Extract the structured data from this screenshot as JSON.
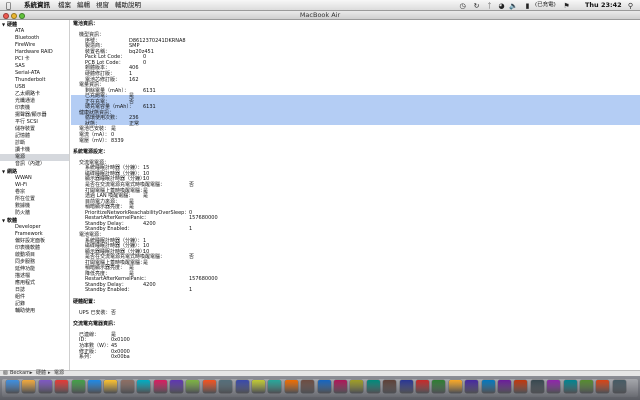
{
  "menubar": {
    "apple": "",
    "items": [
      "系統資訊",
      "檔案",
      "編輯",
      "視窗",
      "輔助說明"
    ],
    "clock": "Thu 23:42",
    "status_text": "(已充電)"
  },
  "window": {
    "title": "MacBook Air"
  },
  "sidebar": {
    "groups": [
      {
        "label": "硬體",
        "top": 0,
        "items": [
          "ATA",
          "Bluetooth",
          "FireWire",
          "Hardware RAID",
          "PCI 卡",
          "SAS",
          "Serial-ATA",
          "Thunderbolt",
          "USB",
          "乙太網路卡",
          "光纖通道",
          "印表機",
          "揚聲器/顯示器",
          "平行 SCSI",
          "儲存裝置",
          "記憶體",
          "診斷",
          "讀卡機",
          "電源",
          "音訊（內建）"
        ]
      },
      {
        "label": "網路",
        "items": [
          "WWAN",
          "Wi-Fi",
          "卷宗",
          "所在位置",
          "數據機",
          "防火牆"
        ]
      },
      {
        "label": "軟體",
        "items": [
          "Developer",
          "Framework",
          "偏好設定面板",
          "印表機軟體",
          "啟動項目",
          "同步服務",
          "延伸功能",
          "描述檔",
          "應用程式",
          "日誌",
          "組件",
          "記錄",
          "輔助使用"
        ]
      }
    ],
    "selected": "電源"
  },
  "content": {
    "lines": [
      {
        "t": "電池資訊：",
        "i": 0,
        "s": true
      },
      {
        "t": "",
        "i": 0
      },
      {
        "t": "機型資訊：",
        "i": 1
      },
      {
        "t": "序號：",
        "v": "D8612370241DKRNA8",
        "i": 2
      },
      {
        "t": "製造商：",
        "v": "SMP",
        "i": 2
      },
      {
        "t": "裝置名稱：",
        "v": "bq20z451",
        "i": 2
      },
      {
        "t": "Pack Lot Code：",
        "v": "0",
        "i": 2
      },
      {
        "t": "PCB Lot Code：",
        "v": "0",
        "i": 2
      },
      {
        "t": "韌體版本：",
        "v": "406",
        "i": 2
      },
      {
        "t": "硬體修訂版：",
        "v": "1",
        "i": 2
      },
      {
        "t": "電池芯修訂版：",
        "v": "162",
        "i": 2
      },
      {
        "t": "電量資訊：",
        "i": 1,
        "h": true
      },
      {
        "t": "剩餘電量（mAh）：",
        "v": "6131",
        "i": 2,
        "h": true
      },
      {
        "t": "已充飽電：",
        "v": "是",
        "i": 2,
        "h": true
      },
      {
        "t": "正在充電：",
        "v": "否",
        "i": 2,
        "h": true
      },
      {
        "t": "總充電容量（mAh）：",
        "v": "6131",
        "i": 2,
        "h": true
      },
      {
        "t": "健康狀態資訊：",
        "i": 1
      },
      {
        "t": "循環使用次數：",
        "v": "236",
        "i": 2
      },
      {
        "t": "狀態：",
        "v": "正常",
        "i": 2
      },
      {
        "t": "電池已安裝：",
        "v": "是",
        "i": 1
      },
      {
        "t": "電流（mA）：",
        "v": "0",
        "i": 1
      },
      {
        "t": "電壓（mV）：",
        "v": "8339",
        "i": 1
      },
      {
        "t": "",
        "i": 0
      },
      {
        "t": "系統電源設定：",
        "i": 0,
        "s": true
      },
      {
        "t": "",
        "i": 0
      },
      {
        "t": "交流電電源：",
        "i": 1
      },
      {
        "t": "系統睡眠計時器（分鐘）：",
        "v": "15",
        "i": 2
      },
      {
        "t": "磁碟睡眠計時器（分鐘）：",
        "v": "10",
        "i": 2
      },
      {
        "t": "顯示器睡眠計時器（分鐘）：",
        "v": "10",
        "i": 2
      },
      {
        "t": "是否在交流電源充電式時喚醒電腦：",
        "v": "否",
        "i": 2
      },
      {
        "t": "打開電腦上蓋時喚醒電腦：",
        "v": "是",
        "i": 2
      },
      {
        "t": "透過 LAN 喚醒電腦：",
        "v": "是",
        "i": 2
      },
      {
        "t": "目前電力來源：",
        "v": "是",
        "i": 2
      },
      {
        "t": "稍暗顯示器亮度：",
        "v": "是",
        "i": 2
      },
      {
        "t": "PrioritizeNetworkReachabilityOverSleep：",
        "v": "0",
        "i": 2
      },
      {
        "t": "RestartAfterKernelPanic：",
        "v": "157680000",
        "i": 2
      },
      {
        "t": "Standby Delay：",
        "v": "4200",
        "i": 2
      },
      {
        "t": "Standby Enabled：",
        "v": "1",
        "i": 2
      },
      {
        "t": "電池電源：",
        "i": 1
      },
      {
        "t": "系統睡眠計時器（分鐘）：",
        "v": "1",
        "i": 2
      },
      {
        "t": "磁碟睡眠計時器（分鐘）：",
        "v": "10",
        "i": 2
      },
      {
        "t": "顯示器睡眠計時器（分鐘）：",
        "v": "10",
        "i": 2
      },
      {
        "t": "是否在交流電源充電式時喚醒電腦：",
        "v": "否",
        "i": 2
      },
      {
        "t": "打開電腦上蓋時喚醒電腦：",
        "v": "是",
        "i": 2
      },
      {
        "t": "稍暗顯示器亮度：",
        "v": "是",
        "i": 2
      },
      {
        "t": "降低亮度：",
        "v": "是",
        "i": 2
      },
      {
        "t": "RestartAfterKernelPanic：",
        "v": "157680000",
        "i": 2
      },
      {
        "t": "Standby Delay：",
        "v": "4200",
        "i": 2
      },
      {
        "t": "Standby Enabled：",
        "v": "1",
        "i": 2
      },
      {
        "t": "",
        "i": 0
      },
      {
        "t": "硬體配置：",
        "i": 0,
        "s": true
      },
      {
        "t": "",
        "i": 0
      },
      {
        "t": "UPS 已安裝：",
        "v": "否",
        "i": 1
      },
      {
        "t": "",
        "i": 0
      },
      {
        "t": "交流電充電器資訊：",
        "i": 0,
        "s": true
      },
      {
        "t": "",
        "i": 0
      },
      {
        "t": "已連線：",
        "v": "是",
        "i": 1
      },
      {
        "t": "ID：",
        "v": "0x0100",
        "i": 1
      },
      {
        "t": "功率數（W）：",
        "v": "45",
        "i": 1
      },
      {
        "t": "修正版：",
        "v": "0x0000",
        "i": 1
      },
      {
        "t": "系列：",
        "v": "0x00ba",
        "i": 1
      }
    ]
  },
  "pathbar": {
    "segments": [
      "Beckam",
      "硬體",
      "電源"
    ]
  },
  "colors": {
    "highlight": "#b4cdf4",
    "selected": "#d5d8dd"
  },
  "dock": {
    "icons": [
      "#3d8ee0",
      "#f2a93b",
      "#7e57c2",
      "#e53935",
      "#43a047",
      "#1e88e5",
      "#fbc02d",
      "#8d6e63",
      "#00acc1",
      "#d81b60",
      "#5e35b1",
      "#7cb342",
      "#f4511e",
      "#546e7a",
      "#3949ab",
      "#c0ca33",
      "#26a69a",
      "#ef6c00",
      "#6d4c41",
      "#1565c0",
      "#ad1457",
      "#9e9d24",
      "#00897b",
      "#5d4037",
      "#283593",
      "#c62828",
      "#2e7d32",
      "#f9a825",
      "#4527a0",
      "#0277bd",
      "#6a1b9a",
      "#bf360c",
      "#37474f",
      "#8e24aa",
      "#00838f",
      "#558b2f",
      "#d84315",
      "#455a64"
    ]
  }
}
